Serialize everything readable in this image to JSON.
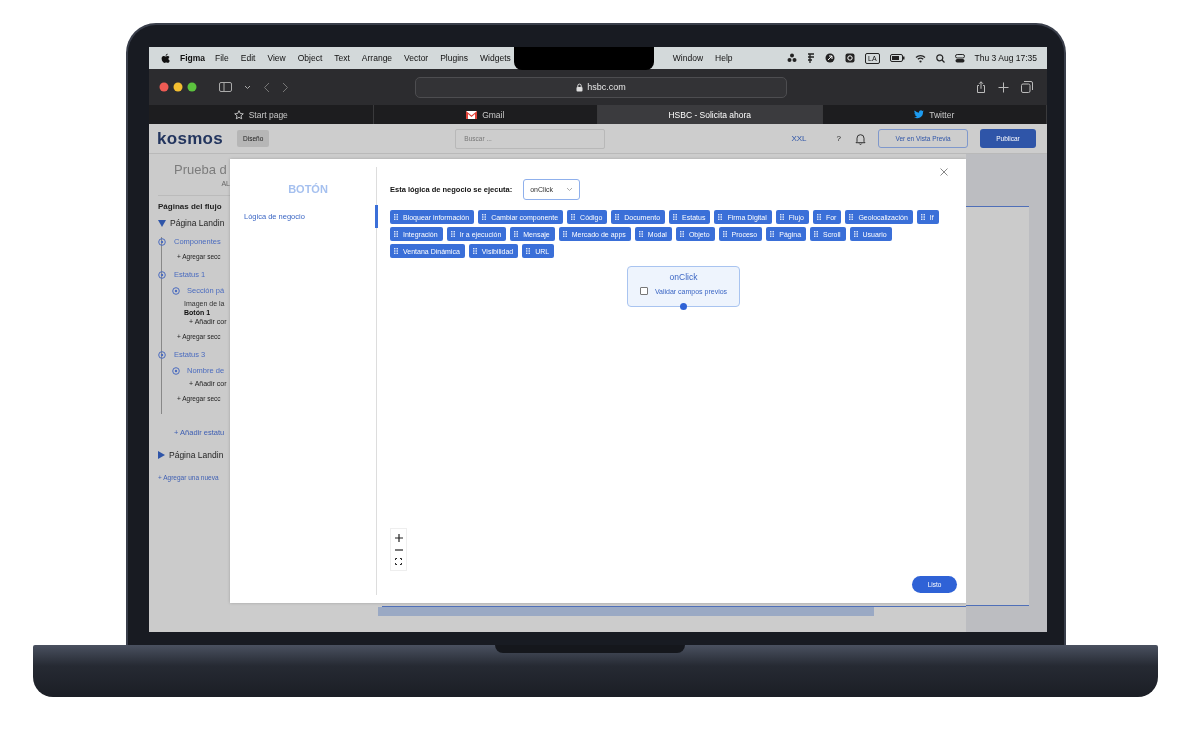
{
  "menubar": {
    "app": "Figma",
    "menus_left": [
      "File",
      "Edit",
      "View",
      "Object",
      "Text",
      "Arrange",
      "Vector",
      "Plugins",
      "Widgets"
    ],
    "menus_right": [
      "Window",
      "Help"
    ],
    "input_source": "LA",
    "clock": "Thu 3 Aug  17:35"
  },
  "browser": {
    "address": "hsbc.com",
    "tabs": [
      {
        "label": "Start page",
        "selected": false
      },
      {
        "label": "Gmail",
        "selected": false
      },
      {
        "label": "HSBC - Solicita ahora",
        "selected": true
      },
      {
        "label": "Twitter",
        "selected": false
      }
    ]
  },
  "app_header": {
    "logo": "kosmos",
    "mode_button": "Diseño",
    "search": {
      "placeholder": "Buscar ..."
    },
    "size": "XXL",
    "help": "?",
    "preview_button": "Ver en Vista Previa",
    "publish_button": "Publicar"
  },
  "flow_panel": {
    "title": "Prueba d",
    "subtitle": "AL",
    "section_title": "Páginas del flujo",
    "pages": [
      {
        "label": "Página Landin",
        "expanded": true,
        "children": [
          {
            "label": "Componentes",
            "add_section": "+ Agregar secc"
          },
          {
            "label": "Estatus 1",
            "children": [
              {
                "label": "Sección pá",
                "children": [
                  {
                    "label": "Imagen de la",
                    "selected": false
                  },
                  {
                    "label": "Botón 1",
                    "selected": true
                  }
                ],
                "add_component": "+ Añadir cor"
              }
            ],
            "add_section": "+ Agregar secc"
          },
          {
            "label": "Estatus 3",
            "children": [
              {
                "label": "Nombre de",
                "add_component": "+ Añadir cor"
              }
            ],
            "add_section": "+ Agregar secc"
          }
        ],
        "add_status": "+ Añadir estatu"
      },
      {
        "label": "Página Landin",
        "expanded": false
      }
    ],
    "add_page": "+ Agregar una nueva"
  },
  "modal": {
    "title": "BOTÓN",
    "nav": [
      {
        "label": "Lógica de negocio",
        "selected": true
      }
    ],
    "trigger_label": "Esta lógica de negocio se ejecuta:",
    "trigger_value": "onClick",
    "blocks": [
      "Bloquear información",
      "Cambiar componente",
      "Código",
      "Documento",
      "Estatus",
      "Firma Digital",
      "Flujo",
      "For",
      "Geolocalización",
      "If",
      "Integración",
      "Ir a ejecución",
      "Mensaje",
      "Mercado de apps",
      "Modal",
      "Objeto",
      "Proceso",
      "Página",
      "Scroll",
      "Usuario",
      "Ventana Dinámica",
      "Visibilidad",
      "URL"
    ],
    "node": {
      "title": "onClick",
      "checkbox_label": "Validar campos previos",
      "checked": false
    },
    "done_button": "Listo"
  }
}
